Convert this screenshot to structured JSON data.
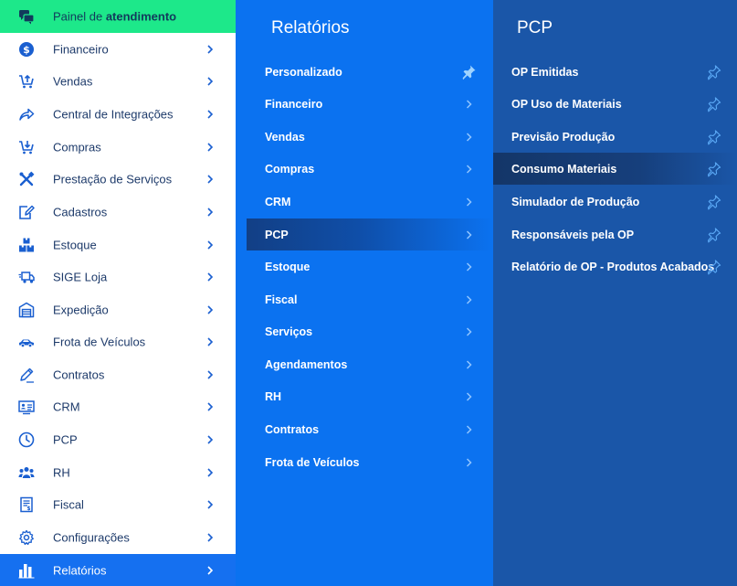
{
  "sidebar": {
    "header": {
      "prefix": "Painel de ",
      "bold": "atendimento",
      "icon": "chat-bubbles-icon"
    },
    "items": [
      {
        "label": "Financeiro",
        "icon": "dollar-circle-icon"
      },
      {
        "label": "Vendas",
        "icon": "cart-up-icon"
      },
      {
        "label": "Central de Integrações",
        "icon": "share-arrow-icon"
      },
      {
        "label": "Compras",
        "icon": "cart-down-icon"
      },
      {
        "label": "Prestação de Serviços",
        "icon": "tools-icon"
      },
      {
        "label": "Cadastros",
        "icon": "edit-document-icon"
      },
      {
        "label": "Estoque",
        "icon": "boxes-icon"
      },
      {
        "label": "SIGE Loja",
        "icon": "delivery-truck-icon"
      },
      {
        "label": "Expedição",
        "icon": "warehouse-icon"
      },
      {
        "label": "Frota de Veículos",
        "icon": "car-icon"
      },
      {
        "label": "Contratos",
        "icon": "pen-icon"
      },
      {
        "label": "CRM",
        "icon": "id-card-icon"
      },
      {
        "label": "PCP",
        "icon": "clock-icon"
      },
      {
        "label": "RH",
        "icon": "people-icon"
      },
      {
        "label": "Fiscal",
        "icon": "receipt-icon"
      },
      {
        "label": "Configurações",
        "icon": "gear-icon"
      },
      {
        "label": "Relatórios",
        "icon": "bar-chart-icon",
        "active": true
      }
    ]
  },
  "reports": {
    "title": "Relatórios",
    "items": [
      {
        "label": "Personalizado",
        "pinned": true
      },
      {
        "label": "Financeiro"
      },
      {
        "label": "Vendas"
      },
      {
        "label": "Compras"
      },
      {
        "label": "CRM"
      },
      {
        "label": "PCP",
        "active": true
      },
      {
        "label": "Estoque"
      },
      {
        "label": "Fiscal"
      },
      {
        "label": "Serviços"
      },
      {
        "label": "Agendamentos"
      },
      {
        "label": "RH"
      },
      {
        "label": "Contratos"
      },
      {
        "label": "Frota de Veículos"
      }
    ]
  },
  "pcp": {
    "title": "PCP",
    "items": [
      {
        "label": "OP Emitidas"
      },
      {
        "label": "OP Uso de Materiais"
      },
      {
        "label": "Previsão Produção"
      },
      {
        "label": "Consumo Materiais",
        "active": true
      },
      {
        "label": "Simulador de Produção"
      },
      {
        "label": "Responsáveis pela OP"
      },
      {
        "label": "Relatório de OP - Produtos Acabados"
      }
    ]
  },
  "colors": {
    "accent_green": "#1de88a",
    "sidebar_active": "#1570f0",
    "reports_panel": "#0b72f0",
    "pcp_panel": "#1a56a8",
    "icon_blue": "#1a5fd0",
    "pin_light": "#9fd3ff"
  }
}
